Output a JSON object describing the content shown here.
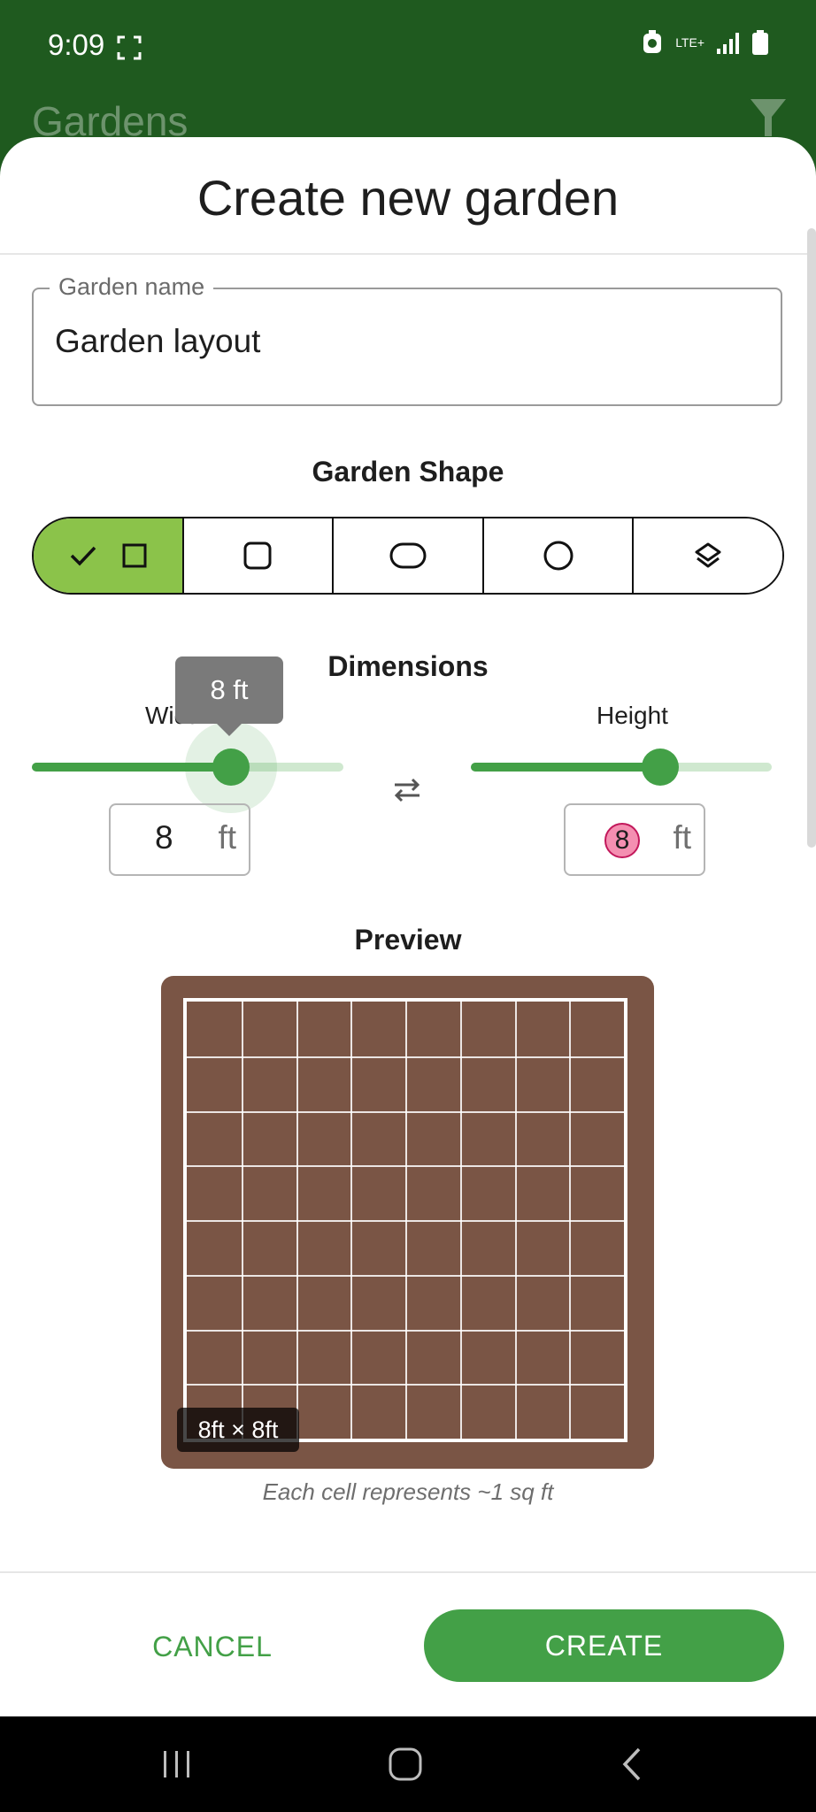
{
  "status_bar": {
    "time": "9:09",
    "network": "LTE+",
    "icons": [
      "screenshot-icon",
      "data-saver-icon",
      "signal-icon",
      "battery-icon"
    ]
  },
  "app": {
    "title": "Gardens",
    "filter_icon": "filter-icon"
  },
  "dialog": {
    "title": "Create new garden",
    "garden_name": {
      "label": "Garden name",
      "value": "Garden layout"
    },
    "shape": {
      "heading": "Garden Shape",
      "options": [
        {
          "icon": "square-icon",
          "selected": true
        },
        {
          "icon": "rounded-square-icon",
          "selected": false
        },
        {
          "icon": "pill-icon",
          "selected": false
        },
        {
          "icon": "circle-icon",
          "selected": false
        },
        {
          "icon": "layers-icon",
          "selected": false
        }
      ]
    },
    "dimensions": {
      "heading": "Dimensions",
      "width": {
        "label": "Width",
        "tooltip": "8 ft",
        "value": "8",
        "unit": "ft",
        "fraction": 0.64
      },
      "height": {
        "label": "Height",
        "value": "8",
        "unit": "ft",
        "fraction": 0.63
      },
      "swap_icon": "swap-horizontal-icon"
    },
    "preview": {
      "heading": "Preview",
      "grid_columns": 8,
      "grid_rows": 8,
      "badge": "8ft × 8ft",
      "caption": "Each cell represents ~1 sq ft"
    },
    "actions": {
      "cancel": "CANCEL",
      "create": "CREATE"
    }
  },
  "colors": {
    "header": "#1f5a1f",
    "accent": "#43a047",
    "selected_segment": "#8bc34a",
    "soil": "#7a5545"
  },
  "nav_bar": {
    "icons": [
      "recent-apps-icon",
      "home-icon",
      "back-icon"
    ]
  }
}
